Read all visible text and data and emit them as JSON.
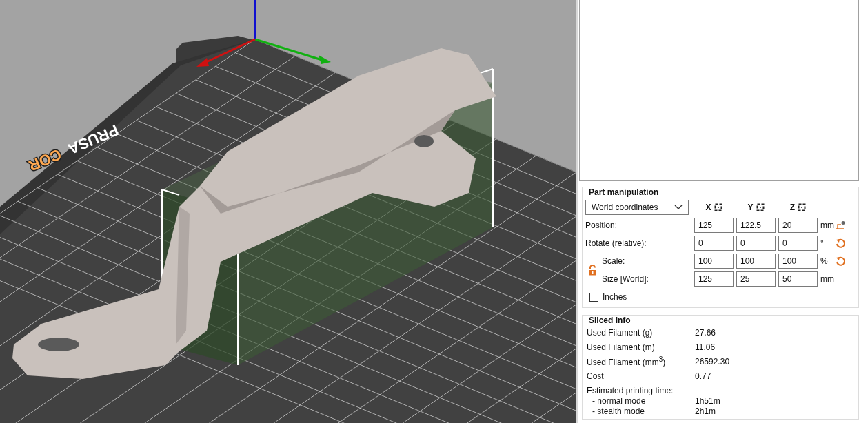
{
  "viewport": {
    "bed_logo": [
      "PRUSA",
      "COR"
    ]
  },
  "part_manipulation": {
    "title": "Part manipulation",
    "coordinates": "World coordinates",
    "axes": [
      "X",
      "Y",
      "Z"
    ],
    "lock": {
      "locked": false
    },
    "rows": [
      {
        "label": "Position:",
        "values": [
          "125",
          "122.5",
          "20"
        ],
        "unit": "mm",
        "kind": "drop"
      },
      {
        "label": "Rotate (relative):",
        "values": [
          "0",
          "0",
          "0"
        ],
        "unit": "°",
        "kind": "reset"
      }
    ],
    "locked_rows": [
      {
        "label": "Scale:",
        "values": [
          "100",
          "100",
          "100"
        ],
        "unit": "%",
        "kind": "reset"
      },
      {
        "label": "Size [World]:",
        "values": [
          "125",
          "25",
          "50"
        ],
        "unit": "mm",
        "kind": "plain"
      }
    ],
    "inches": {
      "label": "Inches",
      "checked": false
    }
  },
  "sliced_info": {
    "title": "Sliced Info",
    "rows": [
      {
        "label": "Used Filament (g)",
        "value": "27.66"
      },
      {
        "label": "Used Filament (m)",
        "value": "11.06"
      },
      {
        "label": "Used Filament (mm$^{3}$)",
        "value": "26592.30"
      },
      {
        "label": "Cost",
        "value": "0.77"
      }
    ],
    "time": {
      "label": "Estimated printing time:",
      "modes": [
        {
          "label": "- normal mode",
          "value": "1h51m"
        },
        {
          "label": "- stealth mode",
          "value": "2h1m"
        }
      ]
    }
  }
}
